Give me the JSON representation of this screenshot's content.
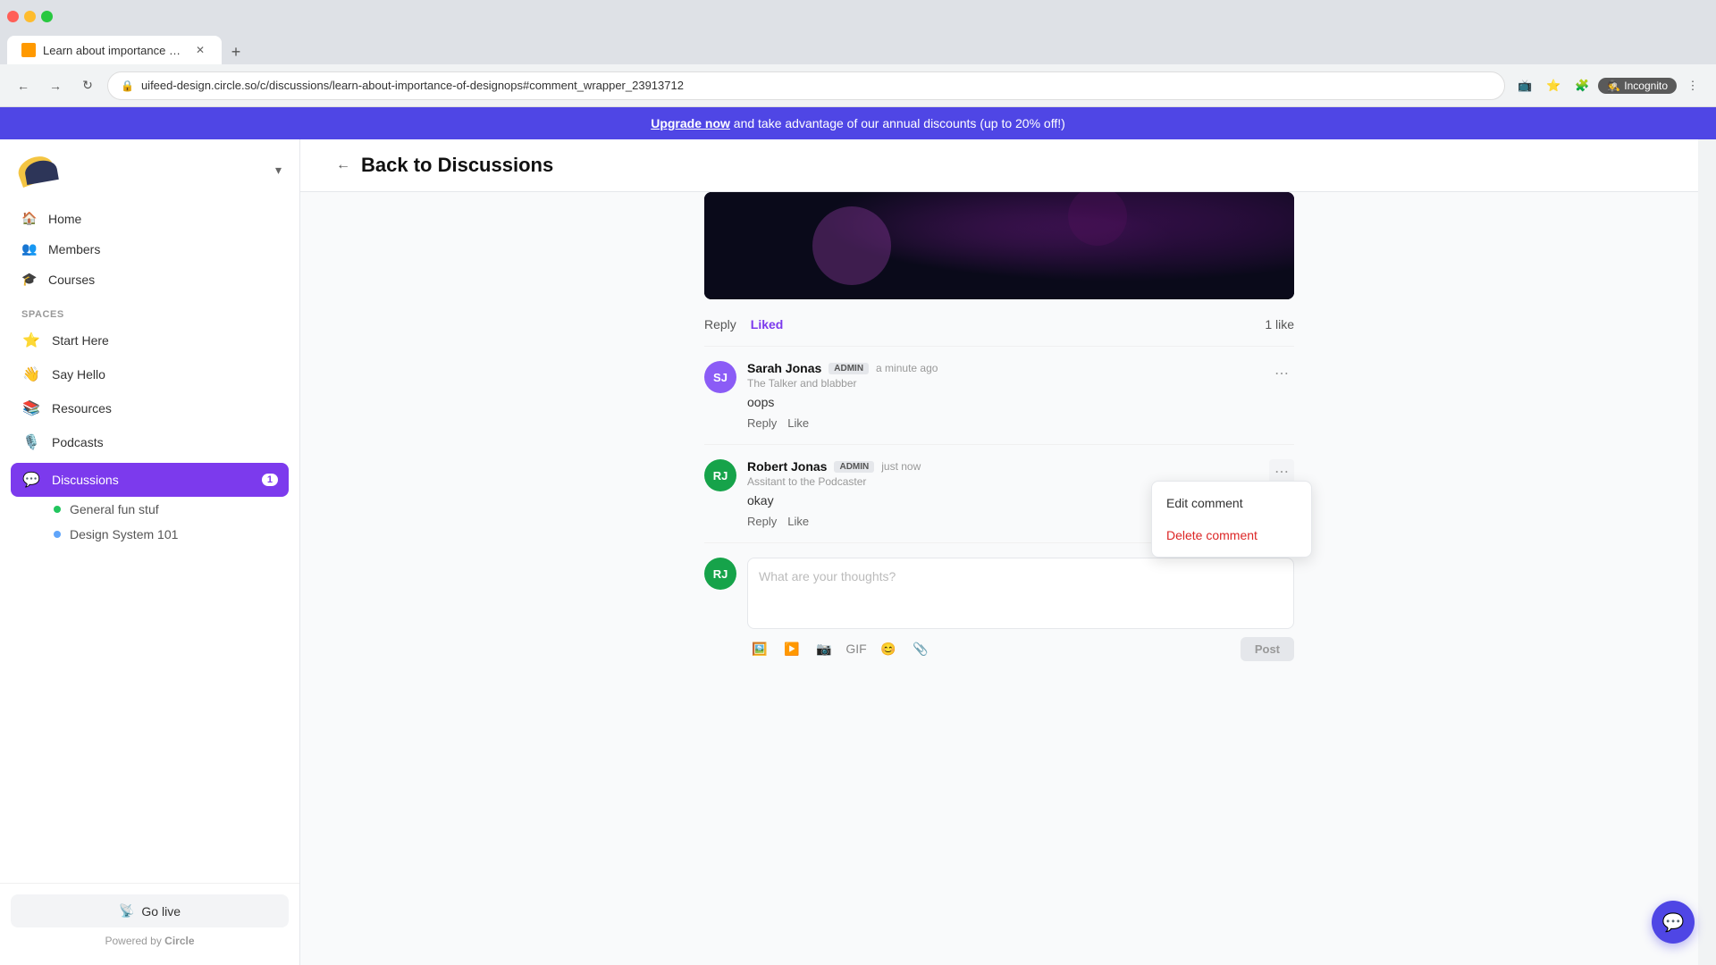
{
  "browser": {
    "tab_title": "Learn about importance of Desig...",
    "address": "uifeed-design.circle.so/c/discussions/learn-about-importance-of-designops#comment_wrapper_23913712",
    "incognito_label": "Incognito"
  },
  "promo": {
    "link_text": "Upgrade now",
    "text": " and take advantage of our annual discounts (up to 20% off!)"
  },
  "sidebar": {
    "nav": [
      {
        "label": "Home",
        "icon": "🏠"
      },
      {
        "label": "Members",
        "icon": "👥"
      },
      {
        "label": "Courses",
        "icon": "🎓"
      }
    ],
    "spaces_title": "Spaces",
    "spaces": [
      {
        "label": "Start Here",
        "icon": "⭐"
      },
      {
        "label": "Say Hello",
        "icon": "👋"
      },
      {
        "label": "Resources",
        "icon": "📚"
      },
      {
        "label": "Podcasts",
        "icon": "🎙️"
      }
    ],
    "discussions": {
      "label": "Discussions",
      "badge": "1"
    },
    "sub_items": [
      {
        "label": "General fun stuf",
        "color": "#22c55e"
      },
      {
        "label": "Design System 101",
        "color": "#60a5fa"
      }
    ],
    "go_live_label": "Go live",
    "powered_by": "Powered by ",
    "circle": "Circle"
  },
  "page": {
    "back_label": "Back to Discussions"
  },
  "comments": [
    {
      "author": "Sarah Jonas",
      "badge": "ADMIN",
      "time": "a minute ago",
      "subtitle": "The Talker and blabber",
      "text": "oops",
      "reply": "Reply",
      "like": "Like",
      "avatar_bg": "#8b5cf6",
      "avatar_text": "SJ"
    },
    {
      "author": "Robert Jonas",
      "badge": "ADMIN",
      "time": "just now",
      "subtitle": "Assitant to the Podcaster",
      "text": "okay",
      "reply": "Reply",
      "like": "Like",
      "avatar_bg": "#16a34a",
      "avatar_text": "RJ"
    }
  ],
  "context_menu": {
    "edit": "Edit comment",
    "delete": "Delete comment"
  },
  "post_box": {
    "placeholder": "What are your thoughts?",
    "post_btn": "Post",
    "avatar_bg": "#16a34a",
    "avatar_text": "RJ"
  },
  "actions": {
    "reply": "Reply",
    "liked": "Liked",
    "likes_count": "1 like"
  }
}
